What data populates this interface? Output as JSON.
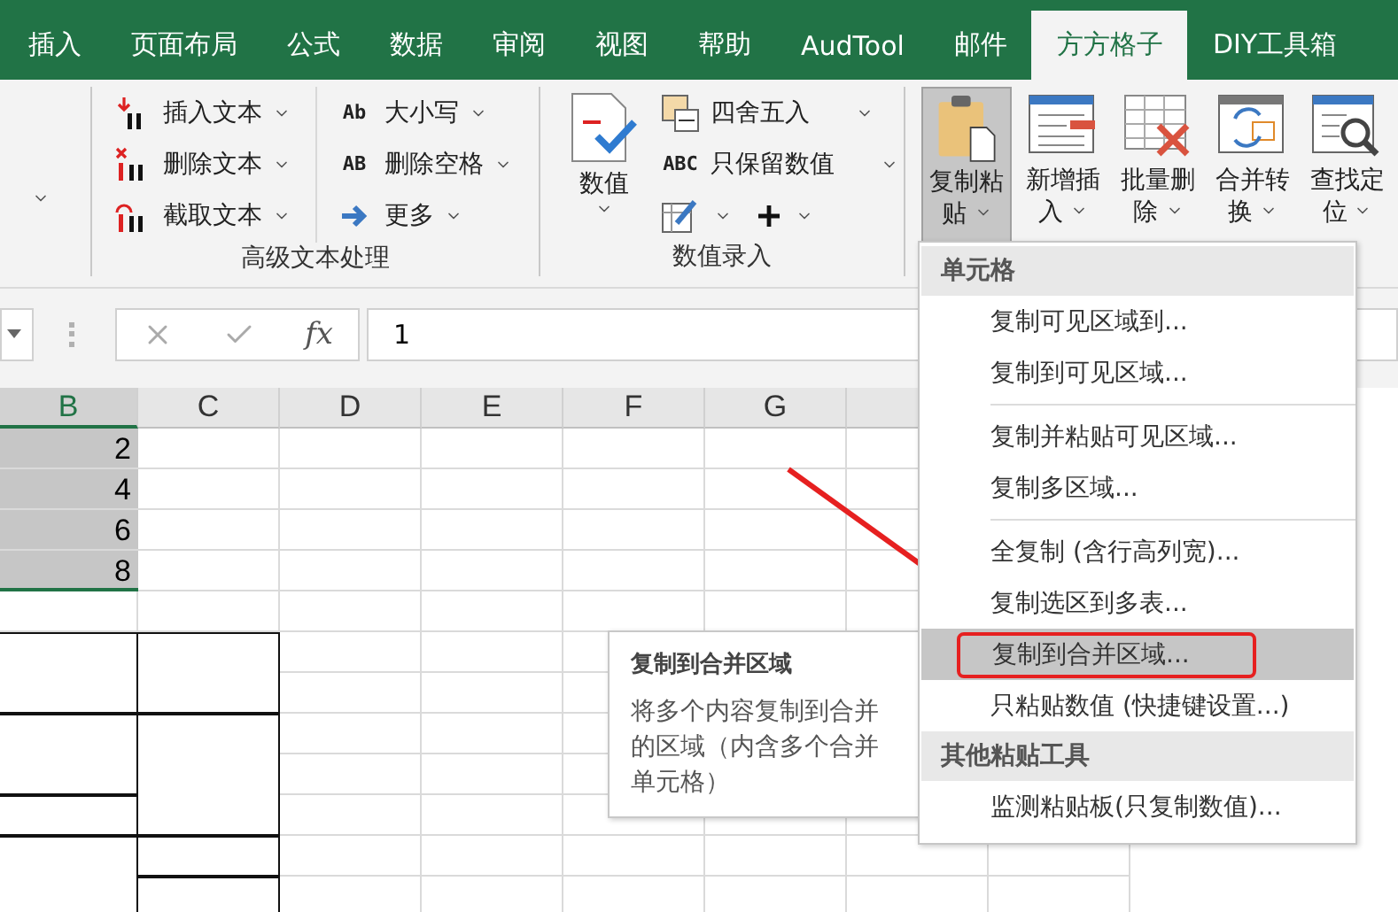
{
  "tabs": [
    {
      "label": "插入",
      "selected": false
    },
    {
      "label": "页面布局",
      "selected": false
    },
    {
      "label": "公式",
      "selected": false
    },
    {
      "label": "数据",
      "selected": false
    },
    {
      "label": "审阅",
      "selected": false
    },
    {
      "label": "视图",
      "selected": false
    },
    {
      "label": "帮助",
      "selected": false
    },
    {
      "label": "AudTool",
      "selected": false
    },
    {
      "label": "邮件",
      "selected": false
    },
    {
      "label": "方方格子",
      "selected": true
    },
    {
      "label": "DIY工具箱",
      "selected": false
    }
  ],
  "ribbon": {
    "text_group": {
      "label": "高级文本处理",
      "columns": [
        [
          {
            "label": "插入文本"
          },
          {
            "label": "删除文本"
          },
          {
            "label": "截取文本"
          }
        ],
        [
          {
            "glyph": "Ab",
            "label": "大小写"
          },
          {
            "glyph": "AB",
            "label": "删除空格"
          },
          {
            "label": "更多"
          }
        ]
      ]
    },
    "number_group": {
      "label": "数值录入",
      "big": {
        "label": "数值"
      },
      "rows": [
        {
          "kind": "labeled",
          "label": "四舍五入"
        },
        {
          "kind": "labeled",
          "glyph": "ABC",
          "label": "只保留数值"
        },
        {
          "kind": "icons"
        }
      ]
    },
    "tool_group": {
      "buttons": [
        {
          "label": "复制粘贴",
          "selected": true
        },
        {
          "label": "新增插入",
          "selected": false
        },
        {
          "label": "批量删除",
          "selected": false
        },
        {
          "label": "合并转换",
          "selected": false
        },
        {
          "label": "查找定位",
          "selected": false
        }
      ]
    }
  },
  "formula_bar": {
    "function_label": "fx",
    "value": "1"
  },
  "sheet": {
    "columns": [
      {
        "label": "B",
        "selected": true
      },
      {
        "label": "C",
        "selected": false
      },
      {
        "label": "D",
        "selected": false
      },
      {
        "label": "E",
        "selected": false
      },
      {
        "label": "F",
        "selected": false
      },
      {
        "label": "G",
        "selected": false
      }
    ],
    "values": [
      "2",
      "4",
      "6",
      "8"
    ]
  },
  "tooltip": {
    "title": "复制到合并区域",
    "text": "将多个内容复制到合并的区域（内含多个合并单元格）"
  },
  "menu": {
    "sections": [
      {
        "title": "单元格",
        "items": [
          {
            "kind": "item",
            "label": "复制可见区域到...",
            "selected": false
          },
          {
            "kind": "item",
            "label": "复制到可见区域...",
            "selected": false
          },
          {
            "kind": "separator"
          },
          {
            "kind": "item",
            "label": "复制并粘贴可见区域...",
            "selected": false
          },
          {
            "kind": "item",
            "label": "复制多区域...",
            "selected": false
          },
          {
            "kind": "separator"
          },
          {
            "kind": "item",
            "label": "全复制 (含行高列宽)...",
            "selected": false
          },
          {
            "kind": "item",
            "label": "复制选区到多表...",
            "selected": false
          },
          {
            "kind": "item",
            "label": "复制到合并区域...",
            "selected": true
          },
          {
            "kind": "item",
            "label": "只粘贴数值 (快捷键设置...)",
            "selected": false
          }
        ]
      },
      {
        "title": "其他粘贴工具",
        "items": [
          {
            "kind": "item",
            "label": "监测粘贴板(只复制数值)...",
            "selected": false
          }
        ]
      }
    ]
  }
}
